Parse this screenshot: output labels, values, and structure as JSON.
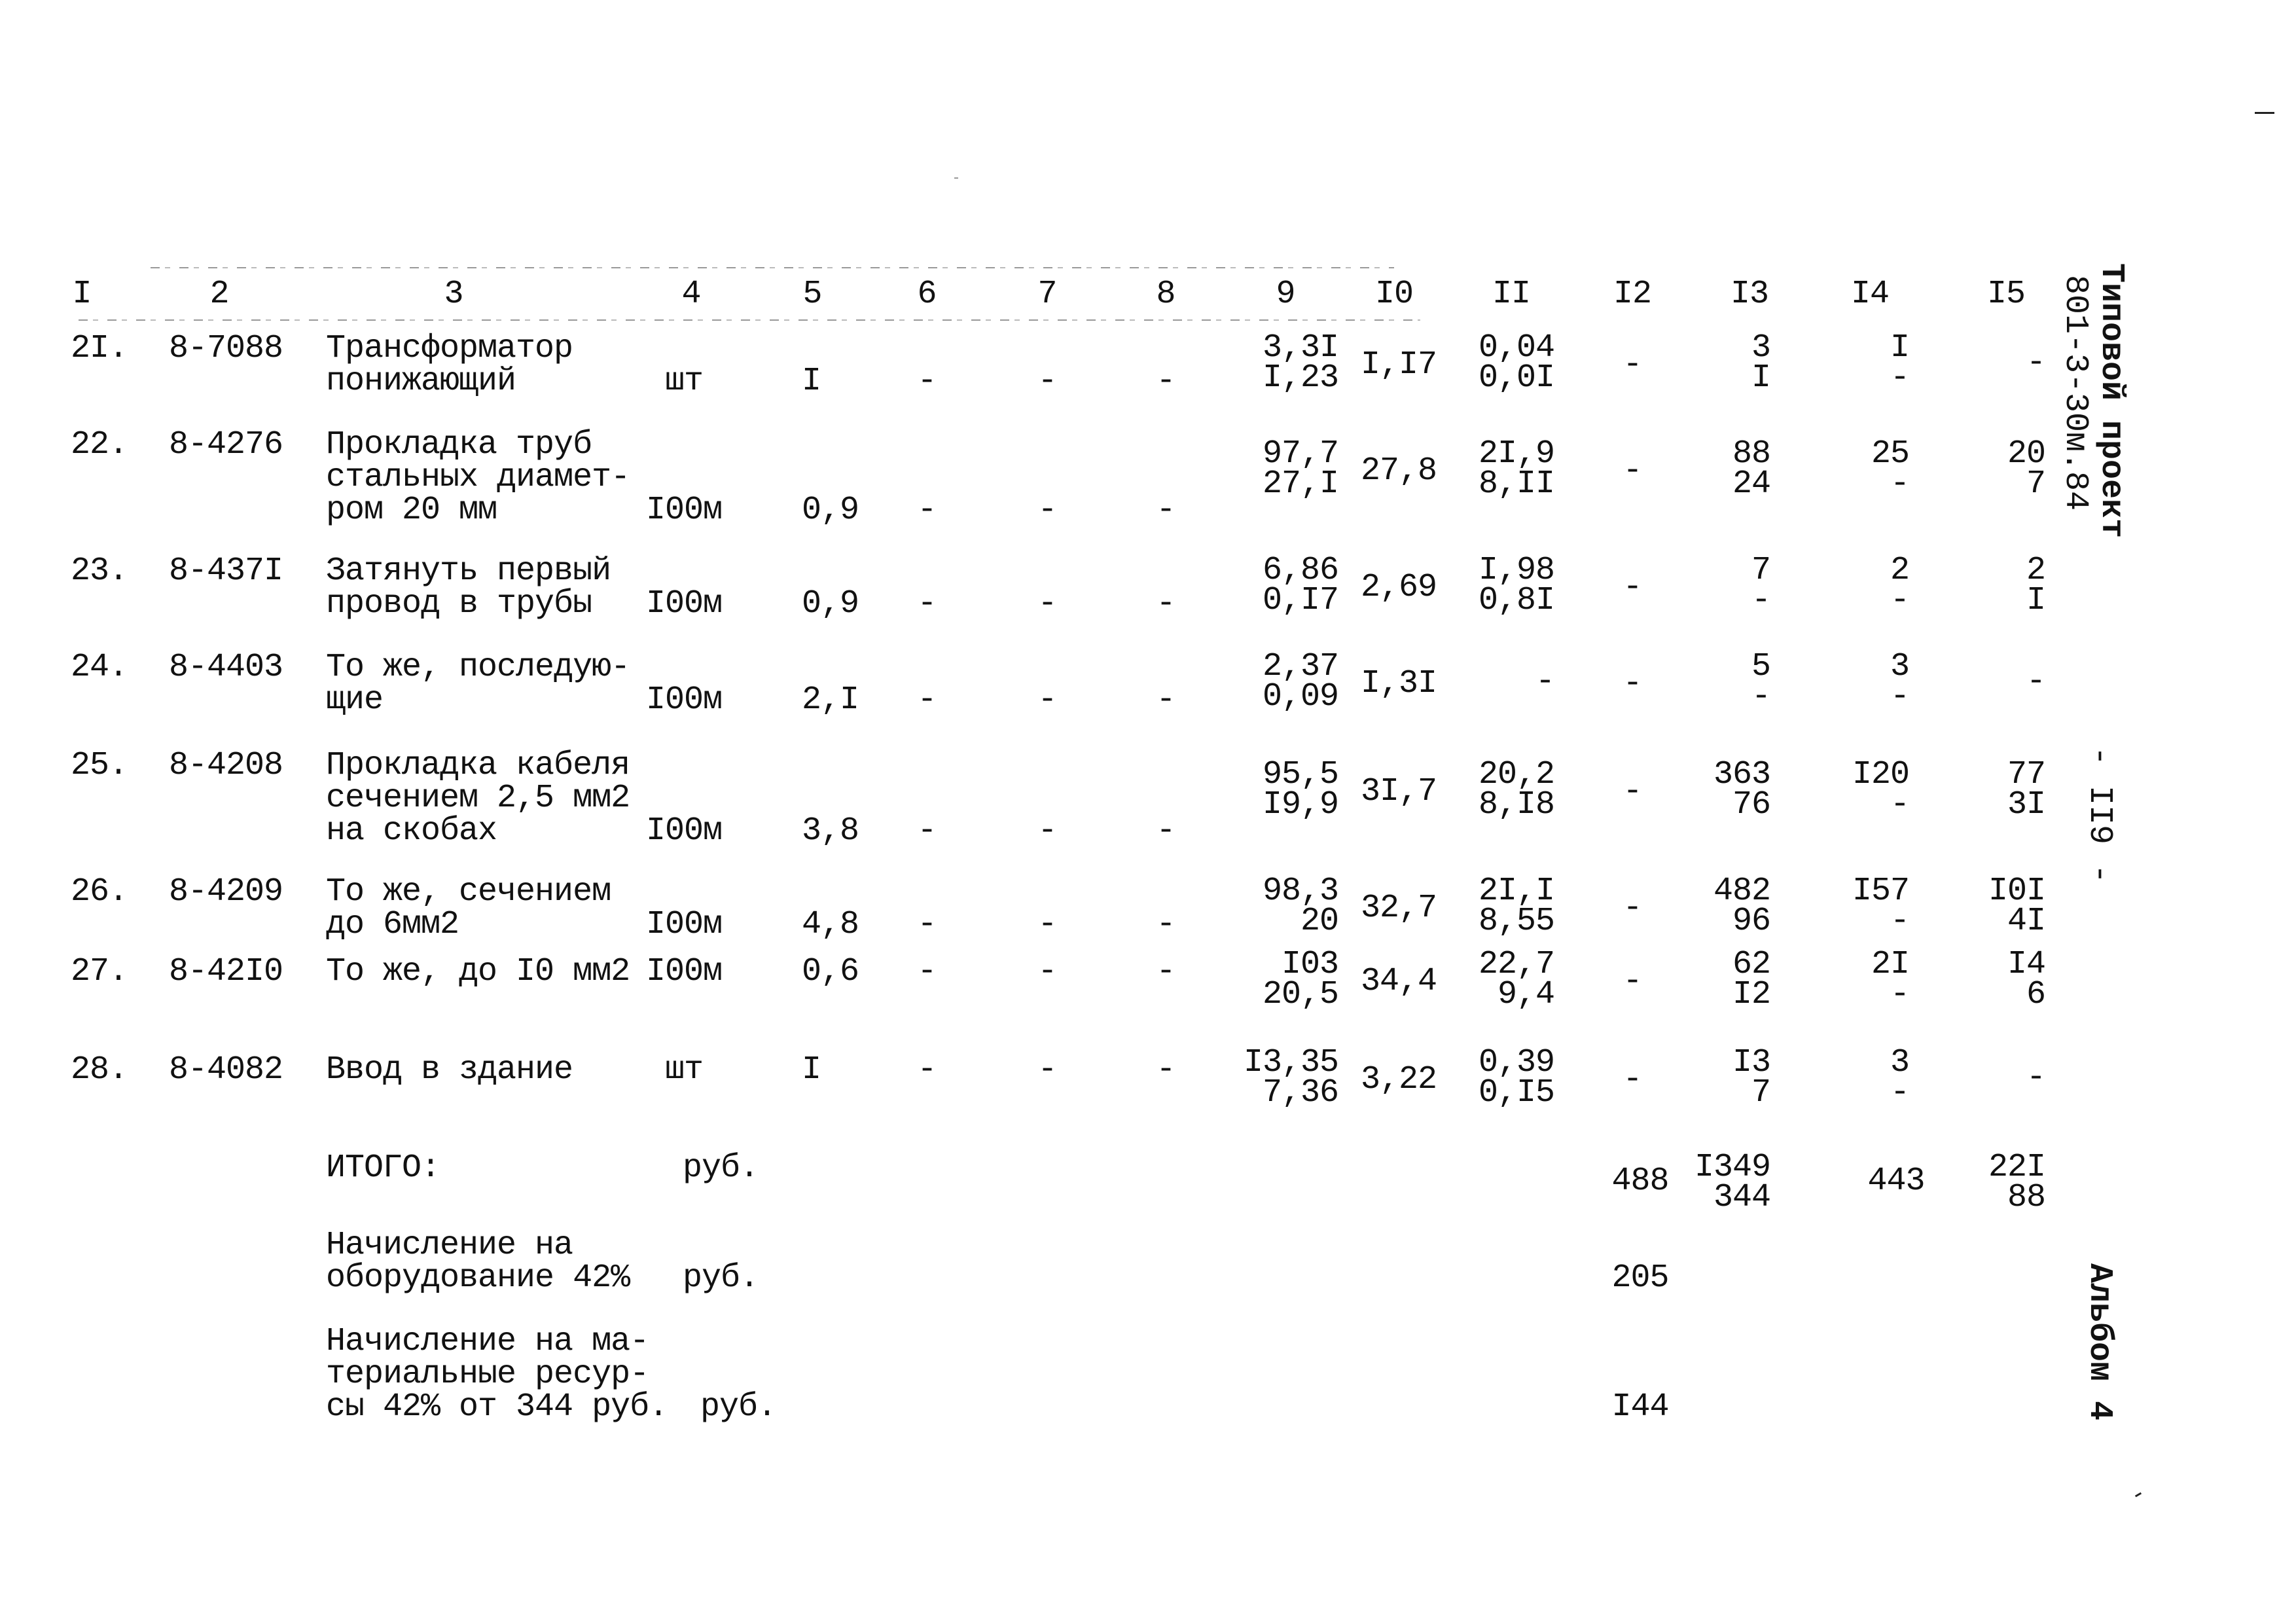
{
  "document": {
    "side_labels": {
      "project_title": "Типовой проект",
      "project_code": "801-3-30м.84",
      "page_number": "- II9 -",
      "album": "Альбом 4"
    },
    "columns": [
      "I",
      "2",
      "3",
      "4",
      "5",
      "6",
      "7",
      "8",
      "9",
      "I0",
      "II",
      "I2",
      "I3",
      "I4",
      "I5"
    ],
    "rows": [
      {
        "no": "2I.",
        "code": "8-7088",
        "name": [
          "Трансформатор",
          "понижающий"
        ],
        "unit": "шт",
        "qty": "I",
        "c6": "-",
        "c7": "-",
        "c8": "-",
        "c9": [
          "3,3I",
          "I,23"
        ],
        "c10": "I,I7",
        "c11": [
          "0,04",
          "0,0I"
        ],
        "c12": "-",
        "c13": [
          "3",
          "I"
        ],
        "c14": [
          "I",
          "-"
        ],
        "c15": [
          "-"
        ]
      },
      {
        "no": "22.",
        "code": "8-4276",
        "name": [
          "Прокладка труб",
          "стальных диамет-",
          "ром 20 мм"
        ],
        "unit": "I00м",
        "qty": "0,9",
        "c6": "-",
        "c7": "-",
        "c8": "-",
        "c9": [
          "97,7",
          "27,I"
        ],
        "c10": "27,8",
        "c11": [
          "2I,9",
          "8,II"
        ],
        "c12": "-",
        "c13": [
          "88",
          "24"
        ],
        "c14": [
          "25",
          "-"
        ],
        "c15": [
          "20",
          "7"
        ]
      },
      {
        "no": "23.",
        "code": "8-437I",
        "name": [
          "Затянуть первый",
          "провод в трубы"
        ],
        "unit": "I00м",
        "qty": "0,9",
        "c6": "-",
        "c7": "-",
        "c8": "-",
        "c9": [
          "6,86",
          "0,I7"
        ],
        "c10": "2,69",
        "c11": [
          "I,98",
          "0,8I"
        ],
        "c12": "-",
        "c13": [
          "7",
          "-"
        ],
        "c14": [
          "2",
          "-"
        ],
        "c15": [
          "2",
          "I"
        ]
      },
      {
        "no": "24.",
        "code": "8-4403",
        "name": [
          "То же, последую-",
          "щие"
        ],
        "unit": "I00м",
        "qty": "2,I",
        "c6": "-",
        "c7": "-",
        "c8": "-",
        "c9": [
          "2,37",
          "0,09"
        ],
        "c10": "I,3I",
        "c11": [
          "-"
        ],
        "c12": "-",
        "c13": [
          "5",
          "-"
        ],
        "c14": [
          "3",
          "-"
        ],
        "c15": [
          "-"
        ]
      },
      {
        "no": "25.",
        "code": "8-4208",
        "name": [
          "Прокладка кабеля",
          "сечением 2,5 мм2",
          "на скобах"
        ],
        "unit": "I00м",
        "qty": "3,8",
        "c6": "-",
        "c7": "-",
        "c8": "-",
        "c9": [
          "95,5",
          "I9,9"
        ],
        "c10": "3I,7",
        "c11": [
          "20,2",
          "8,I8"
        ],
        "c12": "-",
        "c13": [
          "363",
          "76"
        ],
        "c14": [
          "I20",
          "-"
        ],
        "c15": [
          "77",
          "3I"
        ]
      },
      {
        "no": "26.",
        "code": "8-4209",
        "name": [
          "То же, сечением",
          "до 6мм2"
        ],
        "unit": "I00м",
        "qty": "4,8",
        "c6": "-",
        "c7": "-",
        "c8": "-",
        "c9": [
          "98,3",
          "20"
        ],
        "c10": "32,7",
        "c11": [
          "2I,I",
          "8,55"
        ],
        "c12": "-",
        "c13": [
          "482",
          "96"
        ],
        "c14": [
          "I57",
          "-"
        ],
        "c15": [
          "I0I",
          "4I"
        ]
      },
      {
        "no": "27.",
        "code": "8-42I0",
        "name": [
          "То же, до I0 мм2"
        ],
        "unit": "I00м",
        "qty": "0,6",
        "c6": "-",
        "c7": "-",
        "c8": "-",
        "c9": [
          "I03",
          "20,5"
        ],
        "c10": "34,4",
        "c11": [
          "22,7",
          "9,4"
        ],
        "c12": "-",
        "c13": [
          "62",
          "I2"
        ],
        "c14": [
          "2I",
          "-"
        ],
        "c15": [
          "I4",
          "6"
        ]
      },
      {
        "no": "28.",
        "code": "8-4082",
        "name": [
          "Ввод в здание"
        ],
        "unit": "шт",
        "qty": "I",
        "c6": "-",
        "c7": "-",
        "c8": "-",
        "c9": [
          "I3,35",
          "7,36"
        ],
        "c10": "3,22",
        "c11": [
          "0,39",
          "0,I5"
        ],
        "c12": "-",
        "c13": [
          "I3",
          "7"
        ],
        "c14": [
          "3",
          "-"
        ],
        "c15": [
          "-"
        ]
      }
    ],
    "totals": [
      {
        "label": [
          "ИТОГО:"
        ],
        "unit": "руб.",
        "c12": "488",
        "c13": [
          "I349",
          "344"
        ],
        "c14": "443",
        "c15": [
          "22I",
          "88"
        ]
      },
      {
        "label": [
          "Начисление на",
          "оборудование 42%"
        ],
        "unit": "руб.",
        "c12": "205"
      },
      {
        "label": [
          "Начисление на ма-",
          "териальные ресур-",
          "сы 42% от 344 руб."
        ],
        "unit": "руб.",
        "c12": "I44"
      }
    ]
  }
}
